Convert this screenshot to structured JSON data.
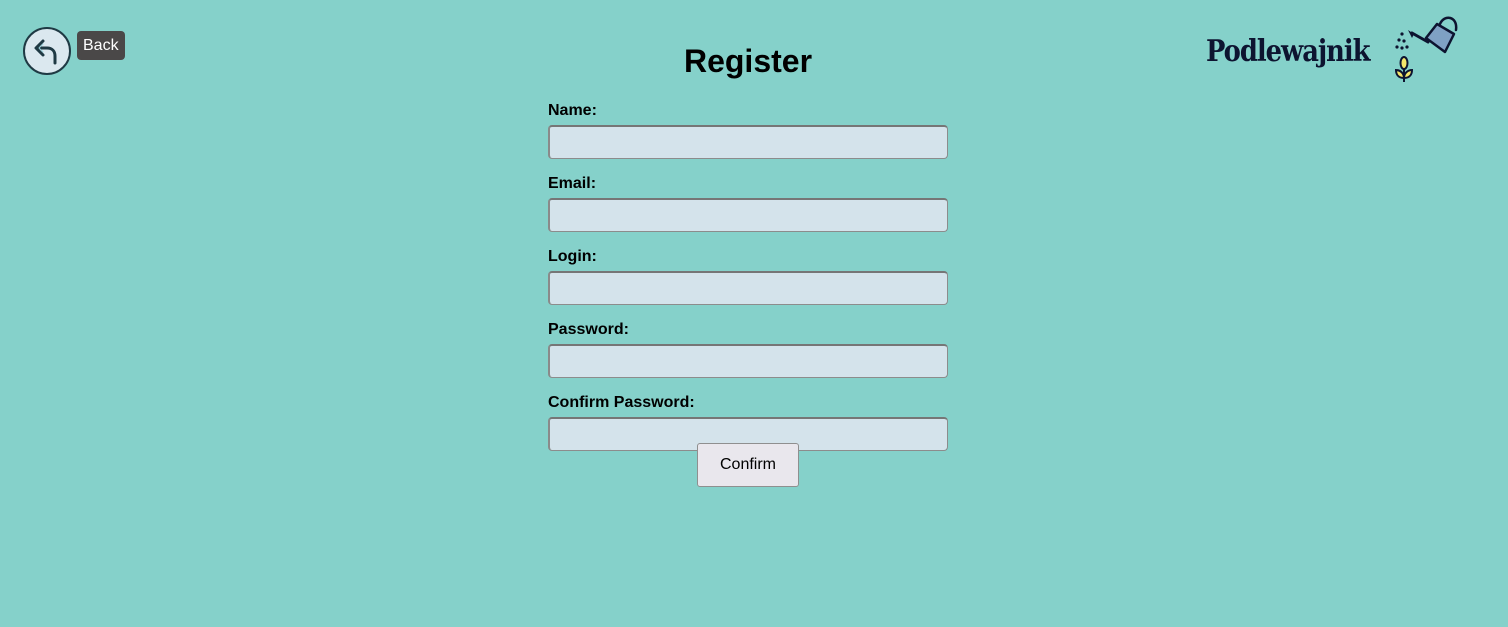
{
  "header": {
    "back_label": "Back",
    "title": "Register",
    "logo_text": "Podlewajnik",
    "logo_icon": "watering-can-sprout-icon",
    "back_icon": "back-arrow-icon"
  },
  "form": {
    "fields": [
      {
        "label": "Name:",
        "value": ""
      },
      {
        "label": "Email:",
        "value": ""
      },
      {
        "label": "Login:",
        "value": ""
      },
      {
        "label": "Password:",
        "value": ""
      },
      {
        "label": "Confirm Password:",
        "value": ""
      }
    ],
    "confirm_label": "Confirm"
  },
  "colors": {
    "background": "#85d1ca",
    "input_background": "#d4e3eb",
    "back_badge": "#4a4848",
    "logo_text": "#0d1430",
    "can_body": "#7fa1c4",
    "sprout": "#f4e66a"
  }
}
